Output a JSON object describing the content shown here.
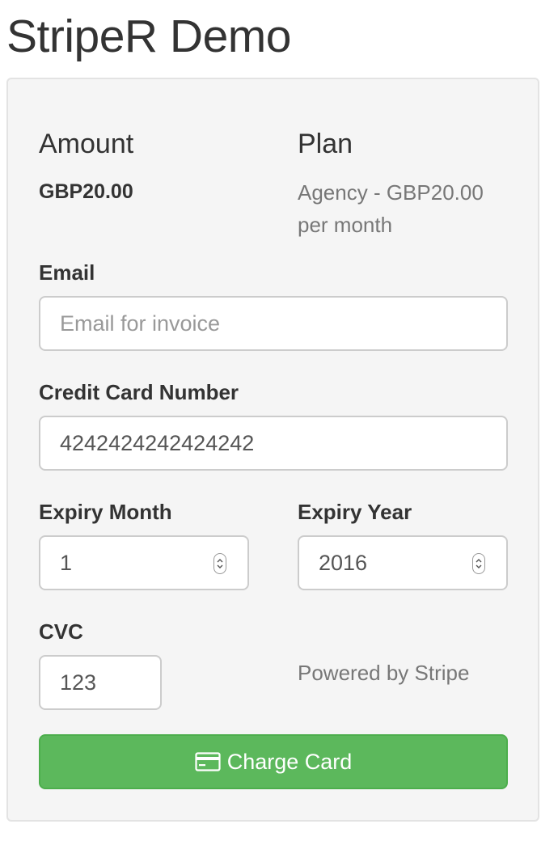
{
  "page": {
    "title": "StripeR Demo"
  },
  "summary": {
    "amount_heading": "Amount",
    "amount_value": "GBP20.00",
    "plan_heading": "Plan",
    "plan_value": "Agency - GBP20.00 per month"
  },
  "form": {
    "email": {
      "label": "Email",
      "value": "",
      "placeholder": "Email for invoice"
    },
    "card_number": {
      "label": "Credit Card Number",
      "value": "4242424242424242"
    },
    "expiry_month": {
      "label": "Expiry Month",
      "value": "1"
    },
    "expiry_year": {
      "label": "Expiry Year",
      "value": "2016"
    },
    "cvc": {
      "label": "CVC",
      "value": "123"
    },
    "powered_by": "Powered by Stripe",
    "submit_label": "Charge Card",
    "submit_icon": "credit-card-icon"
  },
  "colors": {
    "button_bg": "#5cb85c",
    "panel_bg": "#f5f5f5",
    "muted_text": "#777777"
  }
}
